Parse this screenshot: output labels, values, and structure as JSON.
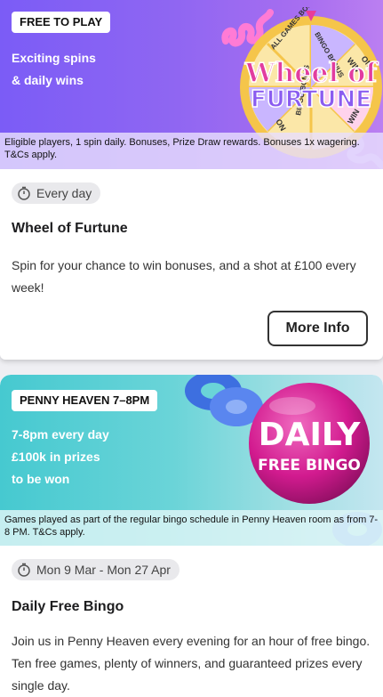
{
  "promos": [
    {
      "tag": "FREE TO PLAY",
      "lines": [
        "Exciting spins",
        "& daily wins"
      ],
      "terms": "Eligible players, 1 spin daily. Bonuses, Prize Draw rewards. Bonuses 1x wagering. T&Cs apply.",
      "artwork_text": [
        "Wheel of",
        "FURTUNE"
      ],
      "artwork_segments": [
        "ALL GAMES BONUS",
        "BINGO BONUS",
        "WIN",
        "ON",
        "BINGO BONUS",
        "WIN",
        "ON"
      ],
      "schedule": "Every day",
      "title": "Wheel of Furtune",
      "description": "Spin for your chance to win bonuses, and a shot at £100 every week!",
      "button_label": "More Info"
    },
    {
      "tag": "PENNY HEAVEN 7–8PM",
      "lines": [
        "7-8pm every day",
        "£100k in prizes",
        "to be won"
      ],
      "terms": "Games played as part of the regular bingo schedule in Penny Heaven room as from 7-8 PM. T&Cs apply.",
      "artwork_text": [
        "DAILY",
        "FREE BINGO"
      ],
      "schedule": "Mon 9 Mar - Mon 27 Apr",
      "title": "Daily Free Bingo",
      "description": "Join us in Penny Heaven every evening for an hour of free bingo. Ten free games, plenty of winners, and guaranteed prizes every single day."
    }
  ],
  "colors": {
    "banner1_start": "#7b5cf6",
    "banner2_start": "#46c9d0",
    "wheel_gold": "#f5c54a",
    "bingo_ball_pink": "#d21b8f"
  }
}
